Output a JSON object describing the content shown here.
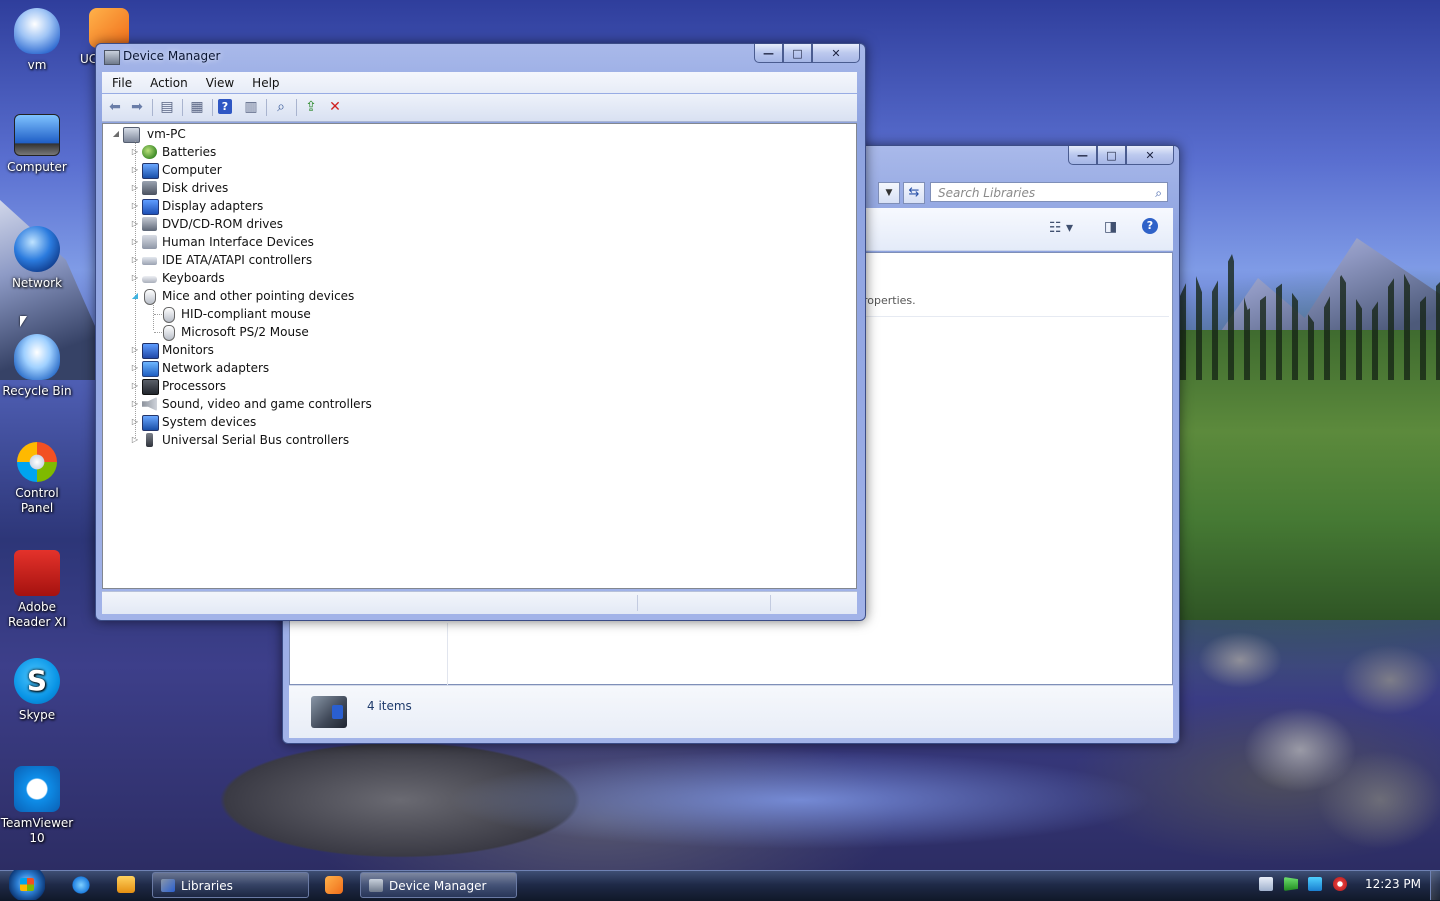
{
  "desktop": {
    "icons": [
      {
        "label": "vm",
        "icon": "user-folder-icon"
      },
      {
        "label": "UC",
        "icon": "uc-browser-icon"
      },
      {
        "label": "Computer",
        "icon": "computer-icon"
      },
      {
        "label": "Network",
        "icon": "network-icon"
      },
      {
        "label": "Recycle Bin",
        "icon": "recycle-bin-icon"
      },
      {
        "label": "Control Panel",
        "icon": "control-panel-icon"
      },
      {
        "label": "Adobe Reader XI",
        "icon": "adobe-reader-icon"
      },
      {
        "label": "Skype",
        "icon": "skype-icon"
      },
      {
        "label": "TeamViewer 10",
        "icon": "teamviewer-icon"
      }
    ]
  },
  "libraries_window": {
    "search_placeholder": "Search Libraries",
    "hint_text": "roperties.",
    "status_items": "4 items",
    "caption": {
      "minimize": "—",
      "maximize": "□",
      "close": "✕"
    }
  },
  "device_manager": {
    "title": "Device Manager",
    "caption": {
      "minimize": "—",
      "maximize": "□",
      "close": "✕"
    },
    "menu": [
      "File",
      "Action",
      "View",
      "Help"
    ],
    "toolbar_icons": [
      "back-icon",
      "forward-icon",
      "show-hide-tree-icon",
      "properties-icon",
      "help-icon",
      "action-pane-icon",
      "scan-hardware-icon",
      "update-driver-icon",
      "uninstall-icon"
    ],
    "tree": {
      "root": "vm-PC",
      "categories": [
        {
          "label": "Batteries",
          "icon": "battery-icon",
          "expanded": false
        },
        {
          "label": "Computer",
          "icon": "computer-icon",
          "expanded": false
        },
        {
          "label": "Disk drives",
          "icon": "disk-drive-icon",
          "expanded": false
        },
        {
          "label": "Display adapters",
          "icon": "display-adapter-icon",
          "expanded": false
        },
        {
          "label": "DVD/CD-ROM drives",
          "icon": "dvd-drive-icon",
          "expanded": false
        },
        {
          "label": "Human Interface Devices",
          "icon": "hid-icon",
          "expanded": false
        },
        {
          "label": "IDE ATA/ATAPI controllers",
          "icon": "ide-controller-icon",
          "expanded": false
        },
        {
          "label": "Keyboards",
          "icon": "keyboard-icon",
          "expanded": false
        },
        {
          "label": "Mice and other pointing devices",
          "icon": "mouse-icon",
          "expanded": true,
          "children": [
            "HID-compliant mouse",
            "Microsoft PS/2 Mouse"
          ]
        },
        {
          "label": "Monitors",
          "icon": "monitor-icon",
          "expanded": false
        },
        {
          "label": "Network adapters",
          "icon": "network-adapter-icon",
          "expanded": false
        },
        {
          "label": "Processors",
          "icon": "processor-icon",
          "expanded": false
        },
        {
          "label": "Sound, video and game controllers",
          "icon": "sound-icon",
          "expanded": false
        },
        {
          "label": "System devices",
          "icon": "system-device-icon",
          "expanded": false
        },
        {
          "label": "Universal Serial Bus controllers",
          "icon": "usb-icon",
          "expanded": false
        }
      ]
    }
  },
  "taskbar": {
    "buttons": [
      {
        "label": "Libraries",
        "icon": "libraries-icon"
      },
      {
        "label": "Device Manager",
        "icon": "device-manager-icon"
      }
    ],
    "quick_launch": [
      "internet-explorer-icon",
      "media-player-icon",
      "uc-browser-icon"
    ],
    "tray": [
      "tray-app-icon",
      "action-center-flag-icon",
      "display-icon",
      "speaker-icon"
    ],
    "clock": "12:23 PM"
  }
}
